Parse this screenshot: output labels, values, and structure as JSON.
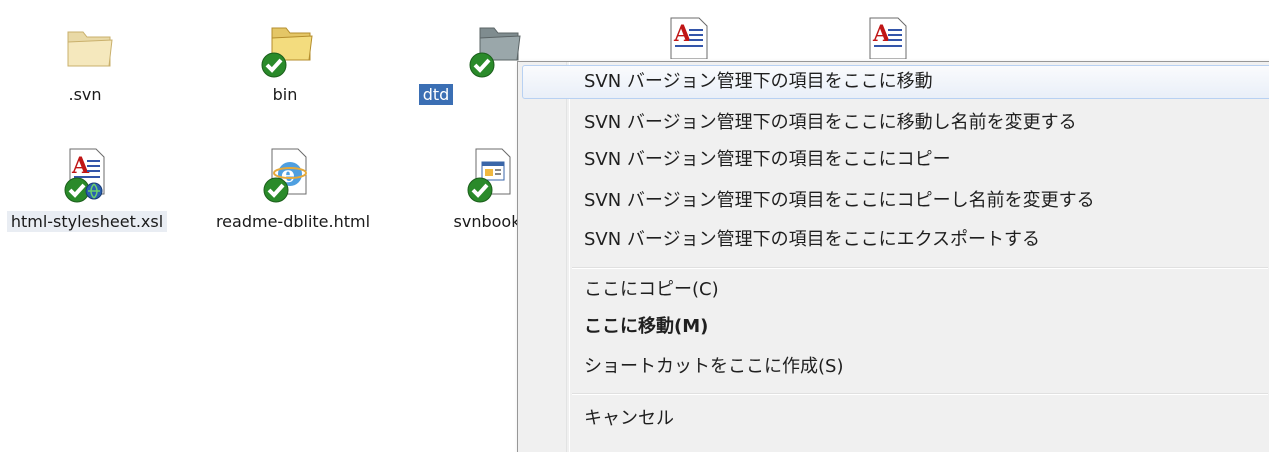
{
  "files": [
    {
      "name": ".svn",
      "type": "folder-icon",
      "badge": false,
      "state": "normal"
    },
    {
      "name": "bin",
      "type": "folder-icon",
      "badge": true,
      "state": "normal"
    },
    {
      "name": "dtd",
      "type": "folder-icon",
      "badge": true,
      "state": "selected"
    },
    {
      "name": "",
      "type": "xsl-document-icon",
      "badge": true,
      "state": "normal"
    },
    {
      "name": "",
      "type": "xsl-document-icon",
      "badge": true,
      "state": "normal"
    },
    {
      "name": "html-stylesheet.xsl",
      "type": "xsl-document-icon",
      "badge": true,
      "state": "hovered"
    },
    {
      "name": "readme-dblite.html",
      "type": "html-document-icon",
      "badge": true,
      "state": "normal"
    },
    {
      "name": "svnbook",
      "type": "web-document-icon",
      "badge": true,
      "state": "normal"
    }
  ],
  "context_menu": {
    "svn_items": [
      "SVN バージョン管理下の項目をここに移動",
      "SVN バージョン管理下の項目をここに移動し名前を変更する",
      "SVN バージョン管理下の項目をここにコピー",
      "SVN バージョン管理下の項目をここにコピーし名前を変更する",
      "SVN バージョン管理下の項目をここにエクスポートする"
    ],
    "shell_items": [
      "ここにコピー(C)",
      "ここに移動(M)",
      "ショートカットをここに作成(S)"
    ],
    "cancel": "キャンセル"
  },
  "colors": {
    "selection": "#3b6fb4",
    "menu_background": "#f0f0f0",
    "menu_hover_border": "#b8d1f2",
    "svn_check": "#2a8a2a"
  }
}
